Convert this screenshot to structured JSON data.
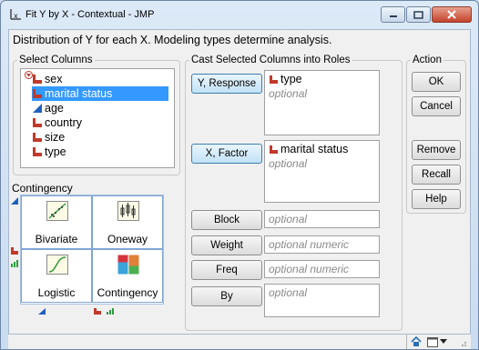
{
  "window": {
    "title": "Fit Y by X - Contextual - JMP"
  },
  "description": "Distribution of Y for each X. Modeling types determine analysis.",
  "select_columns": {
    "legend": "Select Columns",
    "columns": [
      {
        "label": "sex",
        "type": "nominal"
      },
      {
        "label": "marital status",
        "type": "nominal",
        "selected": true
      },
      {
        "label": "age",
        "type": "continuous"
      },
      {
        "label": "country",
        "type": "nominal"
      },
      {
        "label": "size",
        "type": "nominal"
      },
      {
        "label": "type",
        "type": "nominal"
      }
    ]
  },
  "contingency": {
    "label": "Contingency",
    "platforms": [
      {
        "label": "Bivariate"
      },
      {
        "label": "Oneway"
      },
      {
        "label": "Logistic"
      },
      {
        "label": "Contingency"
      }
    ]
  },
  "cast_roles": {
    "legend": "Cast Selected Columns into Roles",
    "y_response": {
      "button": "Y, Response",
      "value": "type",
      "placeholder": "optional"
    },
    "x_factor": {
      "button": "X, Factor",
      "value": "marital status",
      "placeholder": "optional"
    },
    "block": {
      "button": "Block",
      "placeholder": "optional"
    },
    "weight": {
      "button": "Weight",
      "placeholder": "optional numeric"
    },
    "freq": {
      "button": "Freq",
      "placeholder": "optional numeric"
    },
    "by": {
      "button": "By",
      "placeholder": "optional"
    }
  },
  "action": {
    "legend": "Action",
    "ok": "OK",
    "cancel": "Cancel",
    "remove": "Remove",
    "recall": "Recall",
    "help": "Help"
  },
  "colors": {
    "nominal": "#c0392b",
    "continuous": "#1f5fbf",
    "selection": "#3399ff",
    "accent_button": "#c2e2f7"
  }
}
